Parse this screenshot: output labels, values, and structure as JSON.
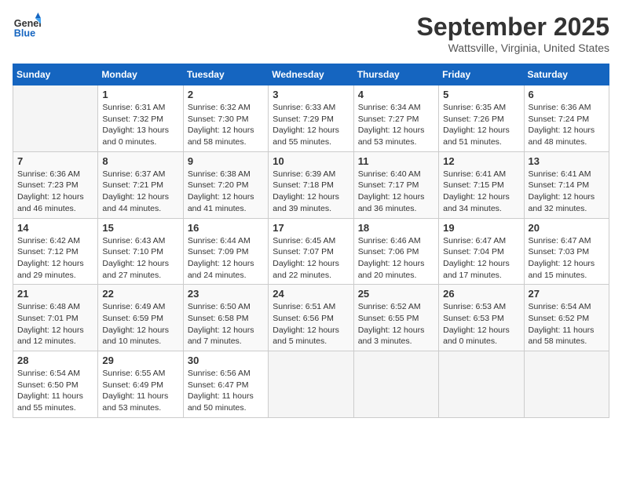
{
  "logo": {
    "line1": "General",
    "line2": "Blue"
  },
  "title": "September 2025",
  "location": "Wattsville, Virginia, United States",
  "days_of_week": [
    "Sunday",
    "Monday",
    "Tuesday",
    "Wednesday",
    "Thursday",
    "Friday",
    "Saturday"
  ],
  "weeks": [
    [
      {
        "day": "",
        "sunrise": "",
        "sunset": "",
        "daylight": ""
      },
      {
        "day": "1",
        "sunrise": "Sunrise: 6:31 AM",
        "sunset": "Sunset: 7:32 PM",
        "daylight": "Daylight: 13 hours and 0 minutes."
      },
      {
        "day": "2",
        "sunrise": "Sunrise: 6:32 AM",
        "sunset": "Sunset: 7:30 PM",
        "daylight": "Daylight: 12 hours and 58 minutes."
      },
      {
        "day": "3",
        "sunrise": "Sunrise: 6:33 AM",
        "sunset": "Sunset: 7:29 PM",
        "daylight": "Daylight: 12 hours and 55 minutes."
      },
      {
        "day": "4",
        "sunrise": "Sunrise: 6:34 AM",
        "sunset": "Sunset: 7:27 PM",
        "daylight": "Daylight: 12 hours and 53 minutes."
      },
      {
        "day": "5",
        "sunrise": "Sunrise: 6:35 AM",
        "sunset": "Sunset: 7:26 PM",
        "daylight": "Daylight: 12 hours and 51 minutes."
      },
      {
        "day": "6",
        "sunrise": "Sunrise: 6:36 AM",
        "sunset": "Sunset: 7:24 PM",
        "daylight": "Daylight: 12 hours and 48 minutes."
      }
    ],
    [
      {
        "day": "7",
        "sunrise": "Sunrise: 6:36 AM",
        "sunset": "Sunset: 7:23 PM",
        "daylight": "Daylight: 12 hours and 46 minutes."
      },
      {
        "day": "8",
        "sunrise": "Sunrise: 6:37 AM",
        "sunset": "Sunset: 7:21 PM",
        "daylight": "Daylight: 12 hours and 44 minutes."
      },
      {
        "day": "9",
        "sunrise": "Sunrise: 6:38 AM",
        "sunset": "Sunset: 7:20 PM",
        "daylight": "Daylight: 12 hours and 41 minutes."
      },
      {
        "day": "10",
        "sunrise": "Sunrise: 6:39 AM",
        "sunset": "Sunset: 7:18 PM",
        "daylight": "Daylight: 12 hours and 39 minutes."
      },
      {
        "day": "11",
        "sunrise": "Sunrise: 6:40 AM",
        "sunset": "Sunset: 7:17 PM",
        "daylight": "Daylight: 12 hours and 36 minutes."
      },
      {
        "day": "12",
        "sunrise": "Sunrise: 6:41 AM",
        "sunset": "Sunset: 7:15 PM",
        "daylight": "Daylight: 12 hours and 34 minutes."
      },
      {
        "day": "13",
        "sunrise": "Sunrise: 6:41 AM",
        "sunset": "Sunset: 7:14 PM",
        "daylight": "Daylight: 12 hours and 32 minutes."
      }
    ],
    [
      {
        "day": "14",
        "sunrise": "Sunrise: 6:42 AM",
        "sunset": "Sunset: 7:12 PM",
        "daylight": "Daylight: 12 hours and 29 minutes."
      },
      {
        "day": "15",
        "sunrise": "Sunrise: 6:43 AM",
        "sunset": "Sunset: 7:10 PM",
        "daylight": "Daylight: 12 hours and 27 minutes."
      },
      {
        "day": "16",
        "sunrise": "Sunrise: 6:44 AM",
        "sunset": "Sunset: 7:09 PM",
        "daylight": "Daylight: 12 hours and 24 minutes."
      },
      {
        "day": "17",
        "sunrise": "Sunrise: 6:45 AM",
        "sunset": "Sunset: 7:07 PM",
        "daylight": "Daylight: 12 hours and 22 minutes."
      },
      {
        "day": "18",
        "sunrise": "Sunrise: 6:46 AM",
        "sunset": "Sunset: 7:06 PM",
        "daylight": "Daylight: 12 hours and 20 minutes."
      },
      {
        "day": "19",
        "sunrise": "Sunrise: 6:47 AM",
        "sunset": "Sunset: 7:04 PM",
        "daylight": "Daylight: 12 hours and 17 minutes."
      },
      {
        "day": "20",
        "sunrise": "Sunrise: 6:47 AM",
        "sunset": "Sunset: 7:03 PM",
        "daylight": "Daylight: 12 hours and 15 minutes."
      }
    ],
    [
      {
        "day": "21",
        "sunrise": "Sunrise: 6:48 AM",
        "sunset": "Sunset: 7:01 PM",
        "daylight": "Daylight: 12 hours and 12 minutes."
      },
      {
        "day": "22",
        "sunrise": "Sunrise: 6:49 AM",
        "sunset": "Sunset: 6:59 PM",
        "daylight": "Daylight: 12 hours and 10 minutes."
      },
      {
        "day": "23",
        "sunrise": "Sunrise: 6:50 AM",
        "sunset": "Sunset: 6:58 PM",
        "daylight": "Daylight: 12 hours and 7 minutes."
      },
      {
        "day": "24",
        "sunrise": "Sunrise: 6:51 AM",
        "sunset": "Sunset: 6:56 PM",
        "daylight": "Daylight: 12 hours and 5 minutes."
      },
      {
        "day": "25",
        "sunrise": "Sunrise: 6:52 AM",
        "sunset": "Sunset: 6:55 PM",
        "daylight": "Daylight: 12 hours and 3 minutes."
      },
      {
        "day": "26",
        "sunrise": "Sunrise: 6:53 AM",
        "sunset": "Sunset: 6:53 PM",
        "daylight": "Daylight: 12 hours and 0 minutes."
      },
      {
        "day": "27",
        "sunrise": "Sunrise: 6:54 AM",
        "sunset": "Sunset: 6:52 PM",
        "daylight": "Daylight: 11 hours and 58 minutes."
      }
    ],
    [
      {
        "day": "28",
        "sunrise": "Sunrise: 6:54 AM",
        "sunset": "Sunset: 6:50 PM",
        "daylight": "Daylight: 11 hours and 55 minutes."
      },
      {
        "day": "29",
        "sunrise": "Sunrise: 6:55 AM",
        "sunset": "Sunset: 6:49 PM",
        "daylight": "Daylight: 11 hours and 53 minutes."
      },
      {
        "day": "30",
        "sunrise": "Sunrise: 6:56 AM",
        "sunset": "Sunset: 6:47 PM",
        "daylight": "Daylight: 11 hours and 50 minutes."
      },
      {
        "day": "",
        "sunrise": "",
        "sunset": "",
        "daylight": ""
      },
      {
        "day": "",
        "sunrise": "",
        "sunset": "",
        "daylight": ""
      },
      {
        "day": "",
        "sunrise": "",
        "sunset": "",
        "daylight": ""
      },
      {
        "day": "",
        "sunrise": "",
        "sunset": "",
        "daylight": ""
      }
    ]
  ]
}
